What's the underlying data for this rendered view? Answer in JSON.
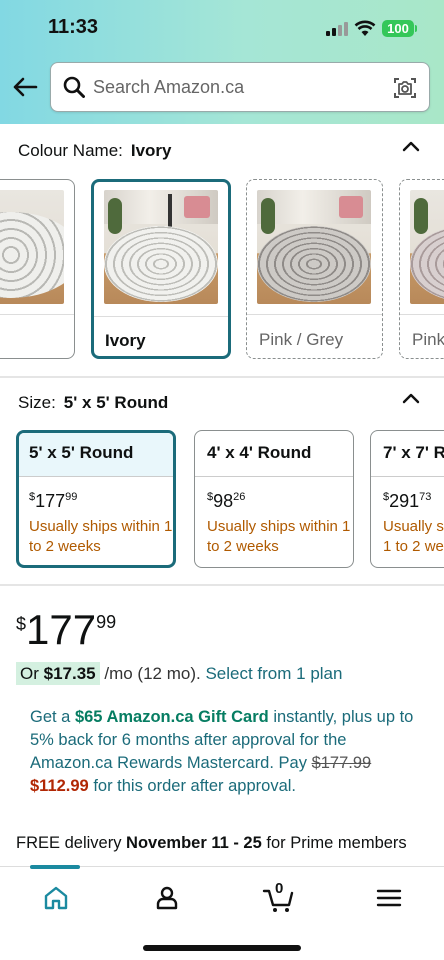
{
  "status_bar": {
    "time": "11:33",
    "battery": "100"
  },
  "search": {
    "placeholder": "Search Amazon.ca"
  },
  "colour": {
    "label": "Colour Name:",
    "selected": "Ivory",
    "options": [
      {
        "label": ""
      },
      {
        "label": "Ivory",
        "selected": true
      },
      {
        "label": "Pink / Grey",
        "dashed": true
      },
      {
        "label": "Pink",
        "dashed": true
      }
    ]
  },
  "size": {
    "label": "Size:",
    "selected": "5' x 5' Round",
    "options": [
      {
        "name": "5' x 5' Round",
        "price_whole": "177",
        "price_cents": "99",
        "ship": "Usually ships within 1 to 2 weeks"
      },
      {
        "name": "4' x 4' Round",
        "price_whole": "98",
        "price_cents": "26",
        "ship": "Usually ships within 1 to 2 weeks"
      },
      {
        "name": "7' x 7' R",
        "price_whole": "291",
        "price_cents": "73",
        "ship": "Usually sh 1 to 2 we"
      }
    ]
  },
  "price": {
    "currency": "$",
    "whole": "177",
    "cents": "99"
  },
  "monthly": {
    "prefix": "Or",
    "amount": "$17.35",
    "suffix": "/mo (12 mo).",
    "link": "Select from 1 plan"
  },
  "promo": {
    "line1": "Get a",
    "gift": "$65 Amazon.ca Gift Card",
    "line2": "instantly, plus up to 5% back for 6 months after approval for the Amazon.ca Rewards Mastercard.",
    "pay": "Pay",
    "old_price": "$177.99",
    "new_price": "$112.99",
    "line3": "for this order after approval."
  },
  "delivery": {
    "prefix": "FREE delivery",
    "dates": "November 11 - 25",
    "suffix": "for Prime members"
  },
  "tabbar": {
    "items": [
      "home-icon",
      "account-icon",
      "cart-icon",
      "menu-icon"
    ],
    "cart_count": "0",
    "active_color": "#1b8aa0"
  }
}
